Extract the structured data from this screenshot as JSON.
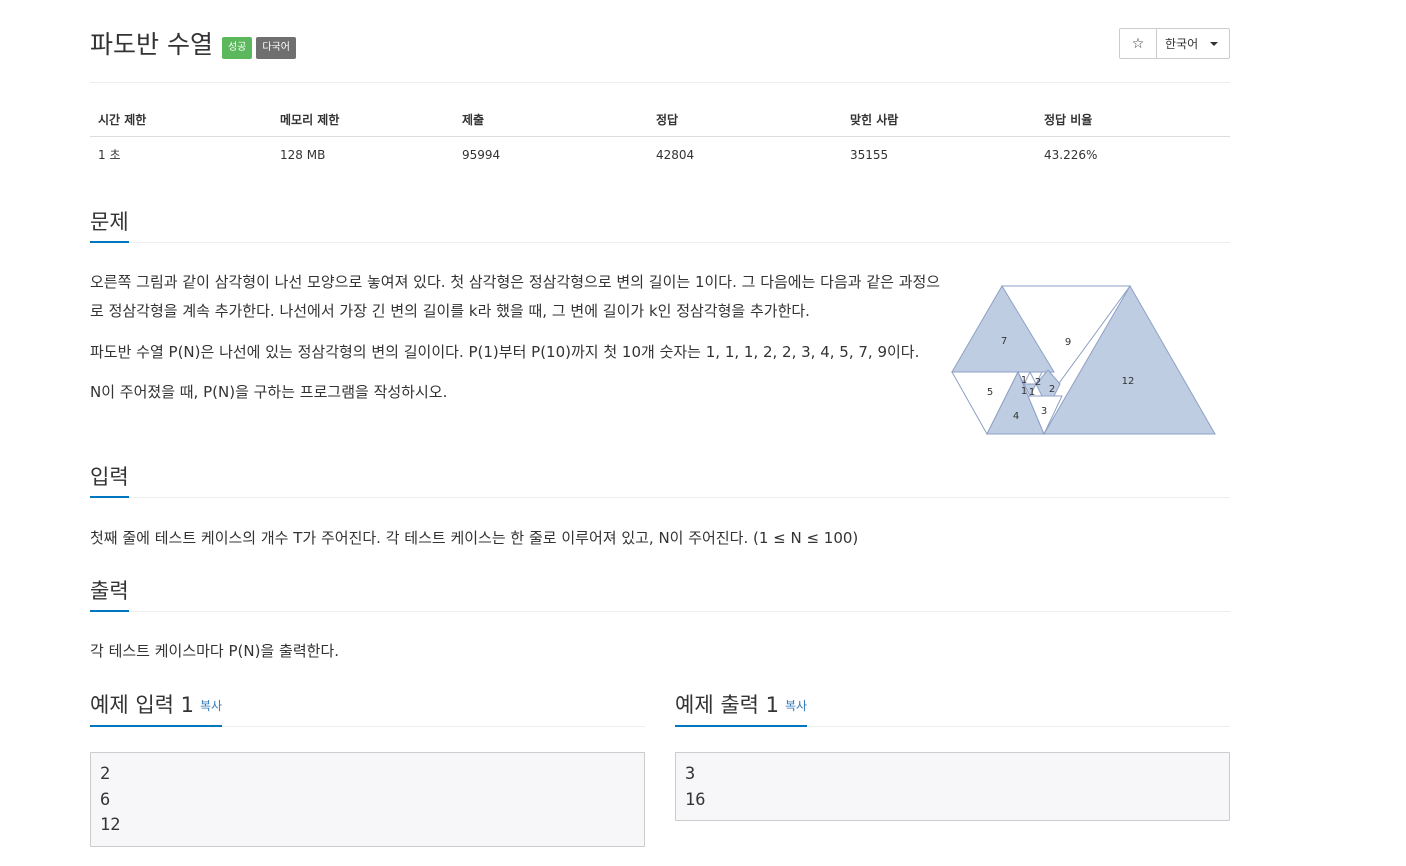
{
  "header": {
    "title": "파도반 수열",
    "badge_success": "성공",
    "badge_multilang": "다국어",
    "star_icon": "star-icon",
    "language": "한국어"
  },
  "info": {
    "headers": [
      "시간 제한",
      "메모리 제한",
      "제출",
      "정답",
      "맞힌 사람",
      "정답 비율"
    ],
    "values": [
      "1 초",
      "128 MB",
      "95994",
      "42804",
      "35155",
      "43.226%"
    ]
  },
  "sections": {
    "problem": {
      "title": "문제",
      "line1": "오른쪽 그림과 같이 삼각형이 나선 모양으로 놓여져 있다. 첫 삼각형은 정삼각형으로 변의 길이는 1이다. 그 다음에는 다음과 같은 과정으",
      "line2": "로 정삼각형을 계속 추가한다. 나선에서 가장 긴 변의 길이를 k라 했을 때, 그 변에 길이가 k인 정삼각형을 추가한다.",
      "line3": "파도반 수열 P(N)은 나선에 있는 정삼각형의 변의 길이이다. P(1)부터 P(10)까지 첫 10개 숫자는 1, 1, 1, 2, 2, 3, 4, 5, 7, 9이다.",
      "line4": "N이 주어졌을 때, P(N)을 구하는 프로그램을 작성하시오."
    },
    "input": {
      "title": "입력",
      "text": "첫째 줄에 테스트 케이스의 개수 T가 주어진다. 각 테스트 케이스는 한 줄로 이루어져 있고, N이 주어진다. (1 ≤ N ≤ 100)"
    },
    "output": {
      "title": "출력",
      "text": "각 테스트 케이스마다 P(N)을 출력한다."
    }
  },
  "samples": {
    "input": {
      "title": "예제 입력 1",
      "copy": "복사",
      "content": "2\n6\n12"
    },
    "output": {
      "title": "예제 출력 1",
      "copy": "복사",
      "content": "3\n16"
    }
  },
  "figure": {
    "fill_color": "#bfcde3",
    "stroke_color": "#8ea0c4",
    "labels": [
      "7",
      "9",
      "12",
      "5",
      "1",
      "2",
      "2",
      "1",
      "1",
      "4",
      "3"
    ]
  }
}
